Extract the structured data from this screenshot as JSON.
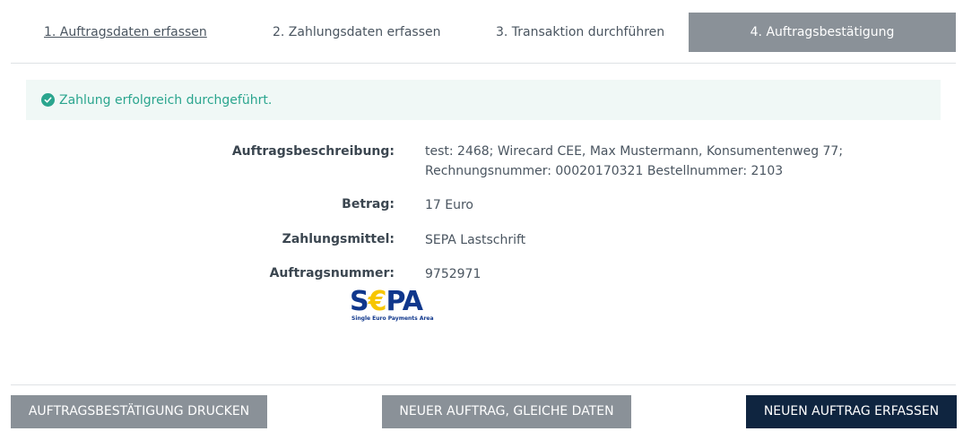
{
  "steps": [
    {
      "label": "1. Auftragsdaten erfassen"
    },
    {
      "label": "2. Zahlungsdaten erfassen"
    },
    {
      "label": "3. Transaktion durchführen"
    },
    {
      "label": "4. Auftragsbestätigung"
    }
  ],
  "alert": {
    "icon": "check-circle-icon",
    "text": "Zahlung erfolgreich durchgeführt.",
    "color": "#2aa58e"
  },
  "details": {
    "description_label": "Auftragsbeschreibung:",
    "description_line1": "test: 2468; Wirecard CEE, Max Mustermann, Konsumentenweg 77;",
    "description_line2": "Rechnungsnummer: 00020170321 Bestellnummer: 2103",
    "amount_label": "Betrag:",
    "amount_value": "17 Euro",
    "method_label": "Zahlungsmittel:",
    "method_value": "SEPA Lastschrift",
    "order_label": "Auftragsnummer:",
    "order_value": "9752971"
  },
  "logo": {
    "name": "sepa-logo",
    "text_s": "S",
    "text_euro": "€",
    "text_pa": "PA",
    "subtitle": "Single Euro Payments Area"
  },
  "buttons": {
    "print": "AUFTRAGSBESTÄTIGUNG DRUCKEN",
    "new_same": "NEUER AUFTRAG, GLEICHE DATEN",
    "new_order": "NEUEN AUFTRAG ERFASSEN"
  },
  "colors": {
    "active_step": "#8a9198",
    "primary_button": "#0f2540",
    "secondary_button": "#8a9198"
  }
}
